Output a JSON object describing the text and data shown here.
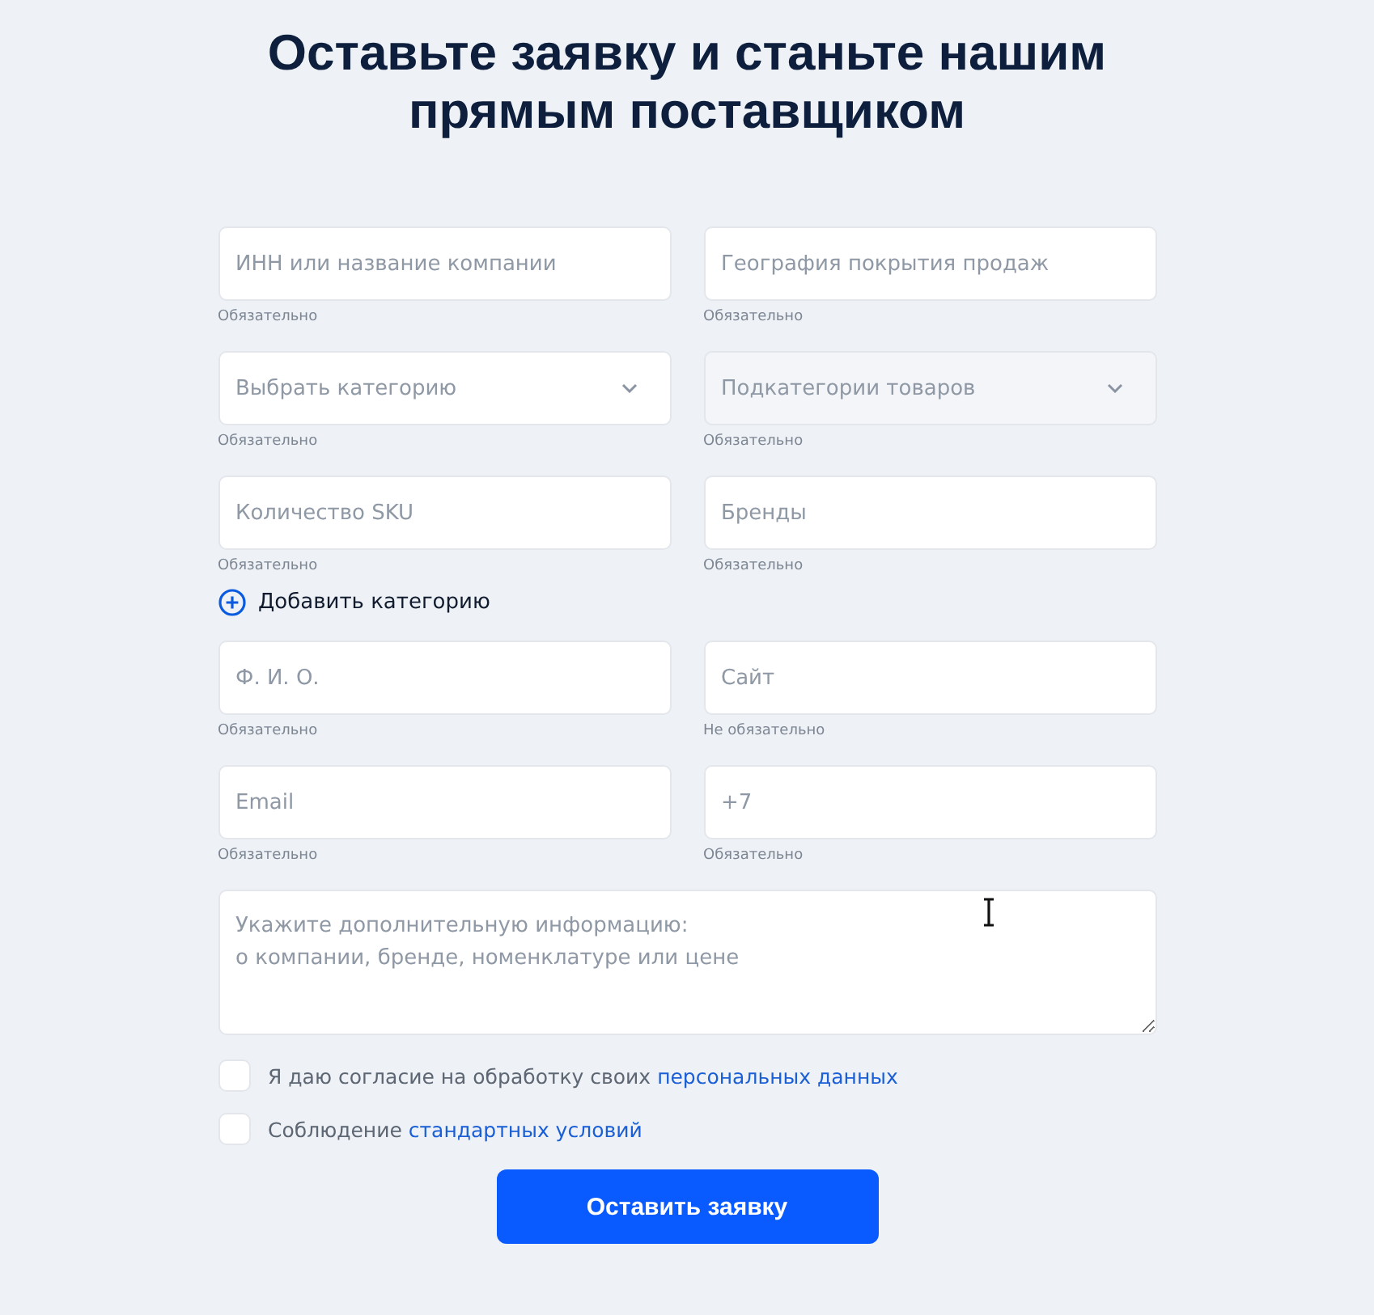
{
  "title": [
    "Оставьте заявку и станьте нашим",
    "прямым поставщиком"
  ],
  "fields": [
    {
      "kind": "text",
      "placeholder": "ИНН или название компании",
      "hint": "Обязательно"
    },
    {
      "kind": "text",
      "placeholder": "География покрытия продаж",
      "hint": "Обязательно"
    },
    {
      "kind": "select",
      "placeholder": "Выбрать категорию",
      "hint": "Обязательно",
      "disabled": false
    },
    {
      "kind": "select",
      "placeholder": "Подкатегории товаров",
      "hint": "Обязательно",
      "disabled": true
    },
    {
      "kind": "text",
      "placeholder": "Количество SKU",
      "hint": "Обязательно"
    },
    {
      "kind": "text",
      "placeholder": "Бренды",
      "hint": "Обязательно"
    }
  ],
  "add_category": {
    "label": "Добавить категорию"
  },
  "contact_fields": [
    {
      "kind": "text",
      "placeholder": "Ф. И. О.",
      "hint": "Обязательно"
    },
    {
      "kind": "text",
      "placeholder": "Сайт",
      "hint": "Не обязательно"
    },
    {
      "kind": "text",
      "placeholder": "Email",
      "hint": "Обязательно"
    },
    {
      "kind": "text",
      "placeholder": "+7",
      "hint": "Обязательно"
    }
  ],
  "comment": {
    "placeholder": "Укажите дополнительную информацию:\nо компании, бренде, номенклатуре или цене"
  },
  "agreements": [
    {
      "text": "Я даю согласие на обработку своих",
      "link": "персональных данных",
      "checked": false
    },
    {
      "text": "Соблюдение",
      "link": "стандартных условий",
      "checked": false
    }
  ],
  "submit": "Оставить заявку"
}
